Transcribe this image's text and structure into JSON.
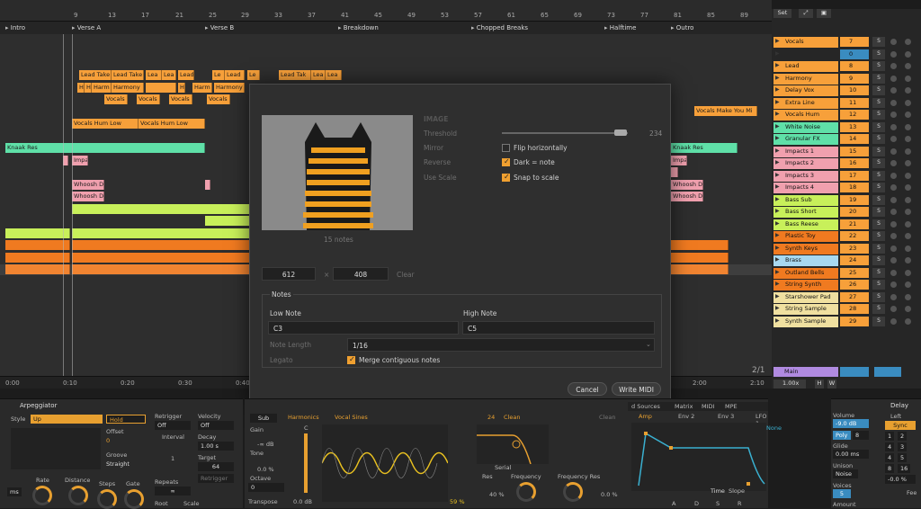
{
  "ruler": {
    "ticks": [
      "9",
      "13",
      "17",
      "21",
      "25",
      "29",
      "33",
      "37",
      "41",
      "45",
      "49",
      "53",
      "57",
      "61",
      "65",
      "69",
      "73",
      "77",
      "81",
      "85",
      "89"
    ]
  },
  "sections": [
    "Intro",
    "Verse A",
    "Verse B",
    "Breakdown",
    "Chopped Breaks",
    "Halftime",
    "Outro"
  ],
  "clips": {
    "lead_take": "Lead Take",
    "lead_take_2": "Lead Tak",
    "lea": "Lea",
    "lead": "Lead",
    "h": "H",
    "harm": "Harm",
    "harmony": "Harmony",
    "le": "Le",
    "vocals": "Vocals",
    "vocals_hum_low": "Vocals Hum Low",
    "knaak_res": "Knaak Res",
    "impa": "Impa",
    "whoosh_d": "Whoosh D",
    "vocals_make": "Vocals Make You Mi",
    "knaak_res2": "Knaak Res",
    "impa2": "Impa",
    "whoosh_d2": "Whoosh D"
  },
  "timeline": {
    "t0": "0:00",
    "t1": "0:10",
    "t2": "0:20",
    "t3": "0:30",
    "t4": "0:40",
    "t5": "2:00",
    "t6": "2:10",
    "ratio": "2/1"
  },
  "header": {
    "set": "Set"
  },
  "tracks": [
    {
      "name": "Vocals",
      "num": "7",
      "color": "#f7a03a"
    },
    {
      "name": "",
      "num": "0",
      "color": "#3a3a3a"
    },
    {
      "name": "Lead",
      "num": "8",
      "color": "#f7a03a"
    },
    {
      "name": "Harmony",
      "num": "9",
      "color": "#f7a03a"
    },
    {
      "name": "Delay Vox",
      "num": "10",
      "color": "#f7a03a"
    },
    {
      "name": "Extra Line",
      "num": "11",
      "color": "#f7a03a"
    },
    {
      "name": "Vocals Hum",
      "num": "12",
      "color": "#f7a03a"
    },
    {
      "name": "White Noise",
      "num": "13",
      "color": "#5fe0a8"
    },
    {
      "name": "Granular FX",
      "num": "14",
      "color": "#5fe0a8"
    },
    {
      "name": "Impacts 1",
      "num": "15",
      "color": "#f0a0ae"
    },
    {
      "name": "Impacts 2",
      "num": "16",
      "color": "#f0a0ae"
    },
    {
      "name": "Impacts 3",
      "num": "17",
      "color": "#f0a0ae"
    },
    {
      "name": "Impacts 4",
      "num": "18",
      "color": "#f0a0ae"
    },
    {
      "name": "Bass Sub",
      "num": "19",
      "color": "#c8f05a"
    },
    {
      "name": "Bass Short",
      "num": "20",
      "color": "#c8f05a"
    },
    {
      "name": "Bass Reese",
      "num": "21",
      "color": "#c8f05a"
    },
    {
      "name": "Plastic Toy",
      "num": "22",
      "color": "#f07a20"
    },
    {
      "name": "Synth Keys",
      "num": "23",
      "color": "#f07a20"
    },
    {
      "name": "Brass",
      "num": "24",
      "color": "#a8d8f0"
    },
    {
      "name": "Outland Bells",
      "num": "25",
      "color": "#f07a20"
    },
    {
      "name": "String Synth",
      "num": "26",
      "color": "#f07a20"
    },
    {
      "name": "Starshower Pad",
      "num": "27",
      "color": "#f0e0a0"
    },
    {
      "name": "String Sample",
      "num": "28",
      "color": "#f0e0a0"
    },
    {
      "name": "Synth Sample",
      "num": "29",
      "color": "#f0e0a0"
    }
  ],
  "main": {
    "label": "Main",
    "zoom": "1.00x",
    "h": "H",
    "w": "W"
  },
  "dialog": {
    "section": "IMAGE",
    "threshold_label": "Threshold",
    "threshold_value": "234",
    "mirror_label": "Mirror",
    "flip": "Flip horizontally",
    "reverse_label": "Reverse",
    "dark": "Dark = note",
    "scale_label": "Use Scale",
    "snap": "Snap to scale",
    "notes_count": "15 notes",
    "width": "612",
    "x": "×",
    "height": "408",
    "clear": "Clear",
    "notes_title": "Notes",
    "low_label": "Low Note",
    "low_value": "C3",
    "high_label": "High Note",
    "high_value": "C5",
    "length_label": "Note Length",
    "length_value": "1/16",
    "legato_label": "Legato",
    "merge": "Merge contiguous notes",
    "cancel": "Cancel",
    "write": "Write MIDI"
  },
  "arp": {
    "title": "Arpeggiator",
    "style_label": "Style",
    "style_value": "Up",
    "hold": "Hold",
    "offset_label": "Offset",
    "offset_value": "0",
    "groove_label": "Groove",
    "groove_value": "Straight",
    "rate": "Rate",
    "distance": "Distance",
    "steps": "Steps",
    "gate": "Gate",
    "gate_value": "50 %",
    "steps_value": "0",
    "retrigger_label": "Retrigger",
    "retrigger_value": "Off",
    "interval_label": "Interval",
    "interval_value": "1",
    "repeats_label": "Repeats",
    "repeats_value": "∞",
    "velocity_label": "Velocity",
    "velocity_value": "Off",
    "decay_label": "Decay",
    "decay_value": "1.00 s",
    "target_label": "Target",
    "target_value": "64",
    "retrigger_btn": "Retrigger",
    "root": "Root",
    "scale": "Scale",
    "ms": "ms"
  },
  "synth": {
    "sub": "Sub",
    "gain": "Gain",
    "gain_value": "-∞ dB",
    "tone": "Tone",
    "tone_value": "0.0 %",
    "octave": "Octave",
    "octave_value": "0",
    "octave_neg": "-1",
    "octave_neg2": "-2",
    "transpose": "Transpose",
    "harmonics": "Harmonics",
    "vocal_sines": "Vocal Sines",
    "c": "C",
    "db": "0.0 dB",
    "pct": "59 %",
    "serial": "Serial",
    "clean": "Clean",
    "clean2": "Clean",
    "res": "Res",
    "res_value": "40 %",
    "freq": "Frequency",
    "freq_res": "Frequency Res",
    "fr_value": "0.0 %",
    "val24": "24"
  },
  "mod": {
    "tabs": [
      "Amp",
      "Env 2",
      "Env 3",
      "LFO 1",
      "LFO 2"
    ],
    "top_tabs": [
      "d Sources",
      "Matrix",
      "MIDI",
      "MPE"
    ],
    "none": "None",
    "time": "Time",
    "slope": "Slope",
    "adsr": [
      "A",
      "D",
      "S",
      "R"
    ]
  },
  "global": {
    "volume": "Volume",
    "volume_value": "-9.0 dB",
    "poly": "Poly",
    "poly_value": "8",
    "glide": "Glide",
    "glide_value": "0.00 ms",
    "unison": "Unison",
    "unison_value": "Noise",
    "voices": "Voices",
    "voices_value": "5",
    "amount": "Amount"
  },
  "delay": {
    "title": "Delay",
    "left": "Left",
    "sync": "Sync",
    "grid": [
      "1",
      "2",
      "4",
      "3",
      "4",
      "5",
      "8",
      "16"
    ],
    "value": "-0.0 %",
    "fee": "Fee"
  }
}
